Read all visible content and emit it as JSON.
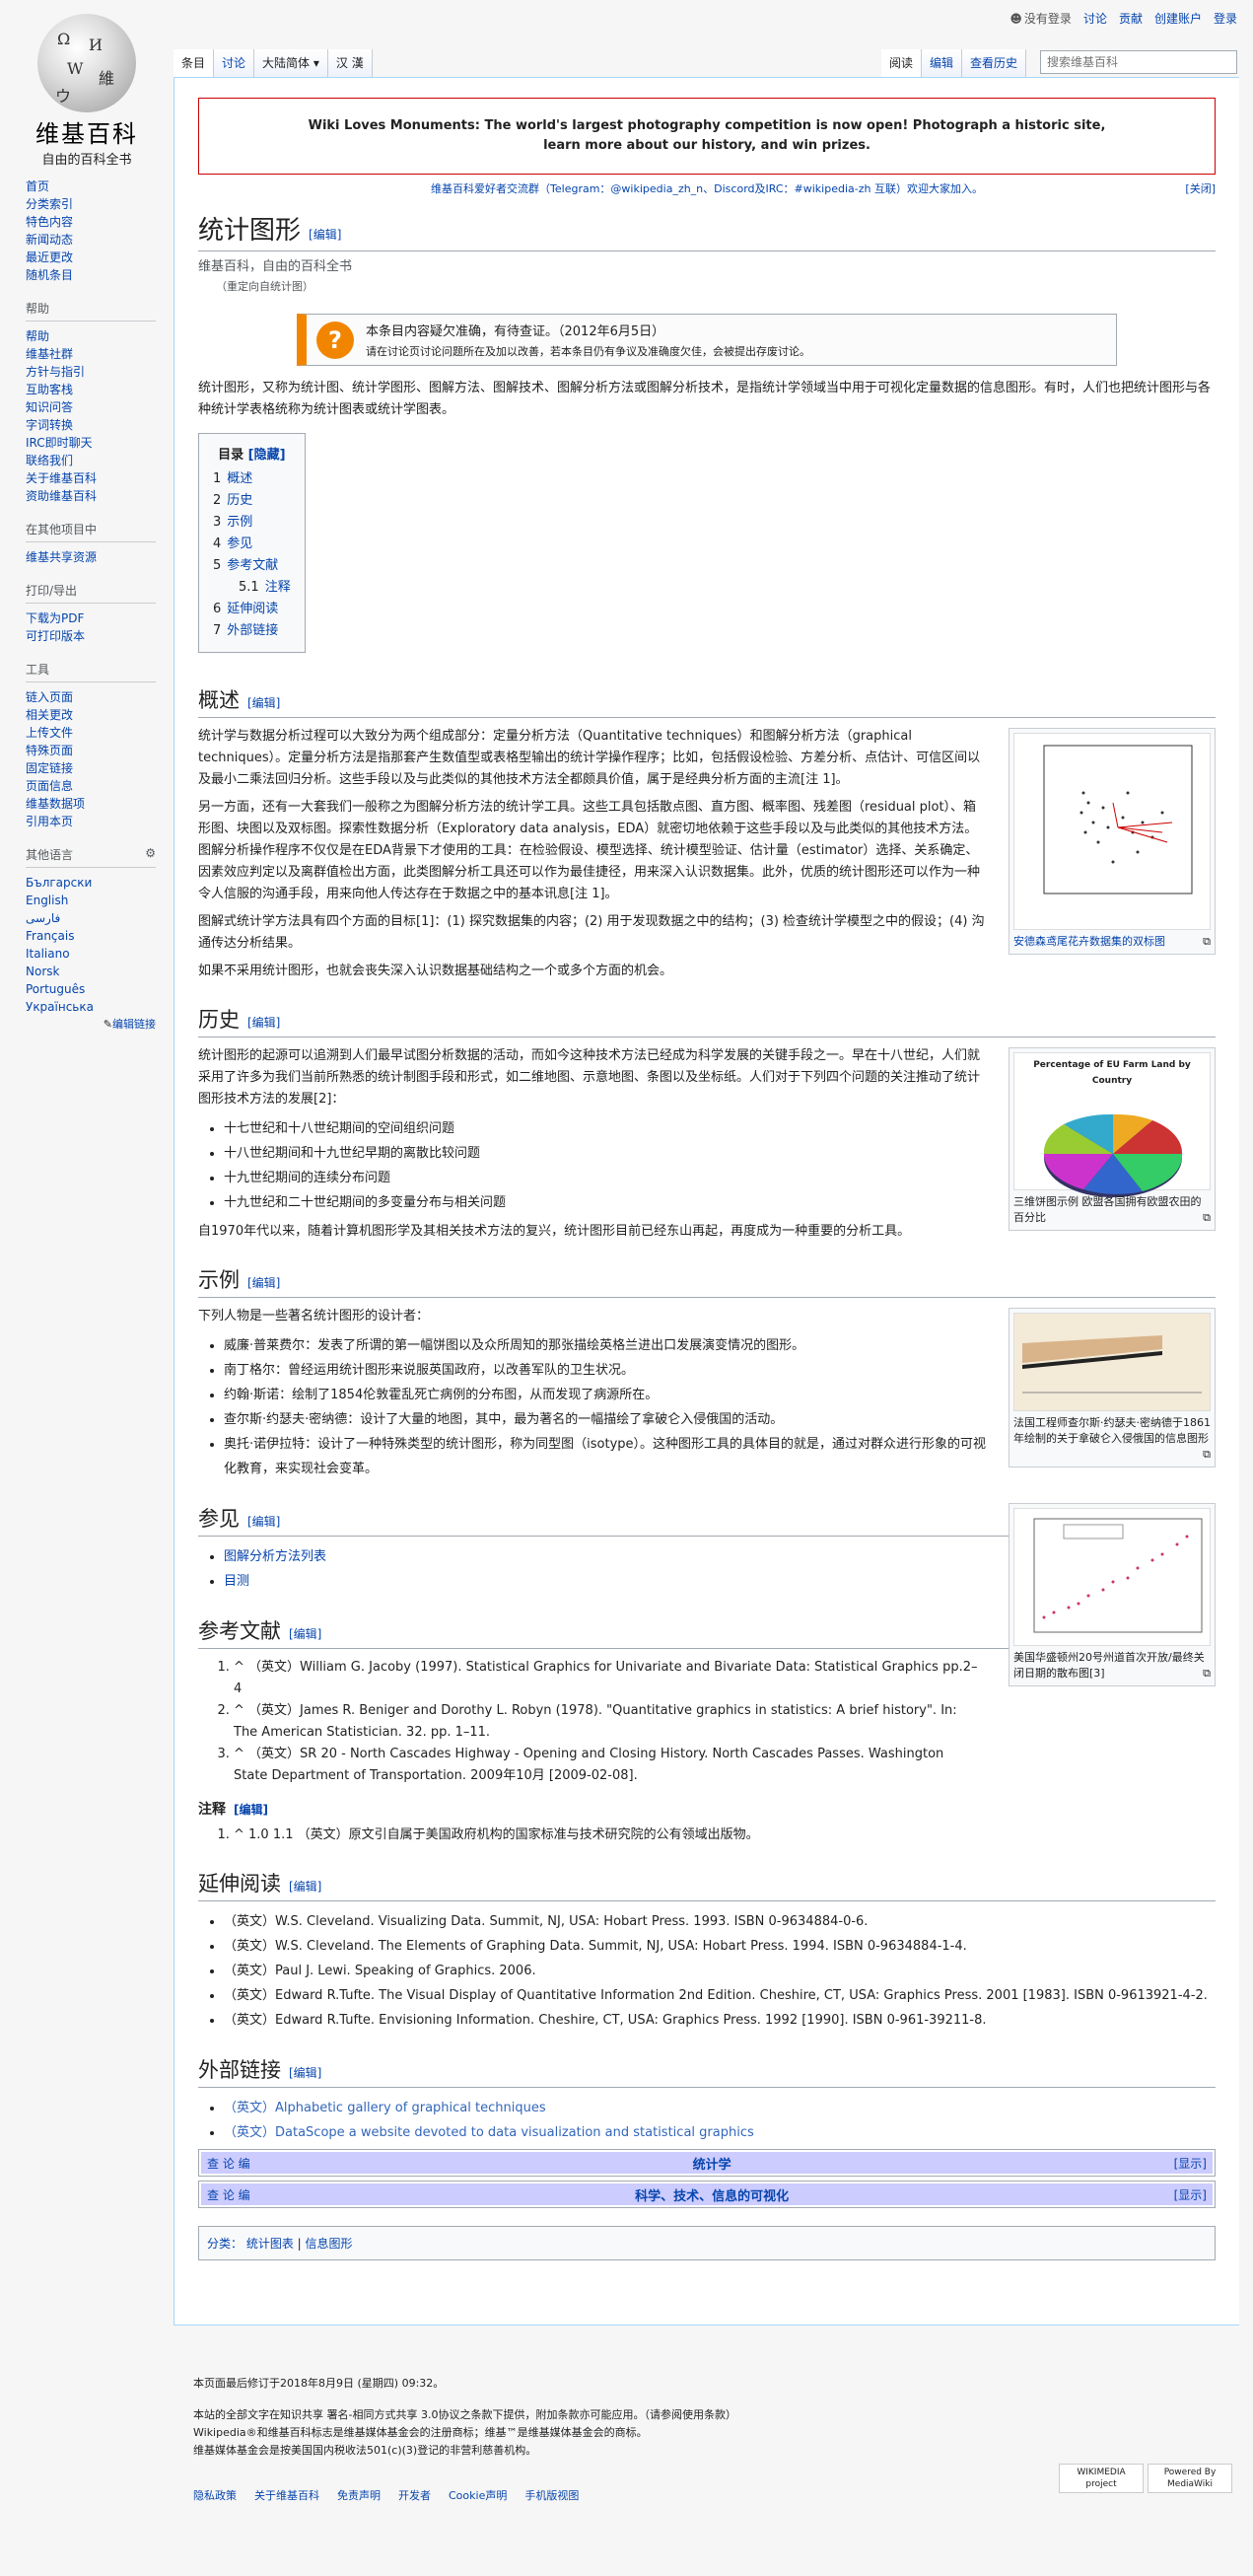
{
  "logo": {
    "title": "维基百科",
    "tagline": "自由的百科全书"
  },
  "personal": {
    "anon": "没有登录",
    "talk": "讨论",
    "contrib": "贡献",
    "create": "创建账户",
    "login": "登录"
  },
  "tabs": {
    "article": "条目",
    "talk": "讨论",
    "variant": "大陆简体",
    "lang": "汉 漢",
    "read": "阅读",
    "edit": "编辑",
    "history": "查看历史"
  },
  "search": {
    "placeholder": "搜索维基百科"
  },
  "sidebar": {
    "main": [
      "首页",
      "分类索引",
      "特色内容",
      "新闻动态",
      "最近更改",
      "随机条目"
    ],
    "help": {
      "title": "帮助",
      "items": [
        "帮助",
        "维基社群",
        "方针与指引",
        "互助客栈",
        "知识问答",
        "字词转换",
        "IRC即时聊天",
        "联络我们",
        "关于维基百科",
        "资助维基百科"
      ]
    },
    "other": {
      "title": "在其他项目中",
      "items": [
        "维基共享资源"
      ]
    },
    "print": {
      "title": "打印/导出",
      "items": [
        "下载为PDF",
        "可打印版本"
      ]
    },
    "tools": {
      "title": "工具",
      "items": [
        "链入页面",
        "相关更改",
        "上传文件",
        "特殊页面",
        "固定链接",
        "页面信息",
        "维基数据项",
        "引用本页"
      ]
    },
    "langs": {
      "title": "其他语言",
      "items": [
        "Български",
        "English",
        "فارسی",
        "Français",
        "Italiano",
        "Norsk",
        "Português",
        "Українська"
      ],
      "edit": "编辑链接"
    }
  },
  "notice": {
    "line1": "Wiki Loves Monuments: The world's largest photography competition is now open! Photograph a historic site,",
    "line2": "learn more about our history, and win prizes."
  },
  "community": {
    "text": "维基百科爱好者交流群（Telegram：@wikipedia_zh_n、Discord及IRC：#wikipedia-zh 互联）欢迎大家加入。",
    "close": "[关闭]"
  },
  "article": {
    "title": "统计图形",
    "edit": "[编辑]",
    "sub": "维基百科，自由的百科全书",
    "redirect": "（重定向自统计图）",
    "ambox": {
      "main": "本条目内容疑欠准确，有待查证。（2012年6月5日）",
      "sub": "请在讨论页讨论问题所在及加以改善，若本条目仍有争议及准确度欠佳，会被提出存废讨论。"
    },
    "intro": "统计图形，又称为统计图、统计学图形、图解方法、图解技术、图解分析方法或图解分析技术，是指统计学领域当中用于可视化定量数据的信息图形。有时，人们也把统计图形与各种统计学表格统称为统计图表或统计学图表。",
    "toc": {
      "title": "目录",
      "hide": "[隐藏]",
      "items": [
        {
          "n": "1",
          "t": "概述"
        },
        {
          "n": "2",
          "t": "历史"
        },
        {
          "n": "3",
          "t": "示例"
        },
        {
          "n": "4",
          "t": "参见"
        },
        {
          "n": "5",
          "t": "参考文献"
        },
        {
          "n": "5.1",
          "t": "注释"
        },
        {
          "n": "6",
          "t": "延伸阅读"
        },
        {
          "n": "7",
          "t": "外部链接"
        }
      ]
    },
    "s1": {
      "title": "概述",
      "p1": "统计学与数据分析过程可以大致分为两个组成部分：定量分析方法（Quantitative techniques）和图解分析方法（graphical techniques）。定量分析方法是指那套产生数值型或表格型输出的统计学操作程序；比如，包括假设检验、方差分析、点估计、可信区间以及最小二乘法回归分析。这些手段以及与此类似的其他技术方法全都颇具价值，属于是经典分析方面的主流[注 1]。",
      "p2": "另一方面，还有一大套我们一般称之为图解分析方法的统计学工具。这些工具包括散点图、直方图、概率图、残差图（residual plot）、箱形图、块图以及双标图。探索性数据分析（Exploratory data analysis，EDA）就密切地依赖于这些手段以及与此类似的其他技术方法。图解分析操作程序不仅仅是在EDA背景下才使用的工具：在检验假设、模型选择、统计模型验证、估计量（estimator）选择、关系确定、因素效应判定以及离群值检出方面，此类图解分析工具还可以作为最佳捷径，用来深入认识数据集。此外，优质的统计图形还可以作为一种令人信服的沟通手段，用来向他人传达存在于数据之中的基本讯息[注 1]。",
      "p3": "图解式统计学方法具有四个方面的目标[1]：(1) 探究数据集的内容；(2) 用于发现数据之中的结构；(3) 检查统计学模型之中的假设；(4) 沟通传达分析结果。",
      "p4": "如果不采用统计图形，也就会丧失深入认识数据基础结构之一个或多个方面的机会。",
      "caption": "安德森鸢尾花卉数据集的双标图"
    },
    "s2": {
      "title": "历史",
      "p1": "统计图形的起源可以追溯到人们最早试图分析数据的活动，而如今这种技术方法已经成为科学发展的关键手段之一。早在十八世纪，人们就采用了许多为我们当前所熟悉的统计制图手段和形式，如二维地图、示意地图、条图以及坐标纸。人们对于下列四个问题的关注推动了统计图形技术方法的发展[2]：",
      "items": [
        "十七世纪和十八世纪期间的空间组织问题",
        "十八世纪期间和十九世纪早期的离散比较问题",
        "十九世纪期间的连续分布问题",
        "十九世纪和二十世纪期间的多变量分布与相关问题"
      ],
      "p2": "自1970年代以来，随着计算机图形学及其相关技术方法的复兴，统计图形目前已经东山再起，再度成为一种重要的分析工具。",
      "caption": "三维饼图示例 欧盟各国拥有欧盟农田的百分比",
      "chart_title": "Percentage of EU Farm Land by Country"
    },
    "s3": {
      "title": "示例",
      "intro": "下列人物是一些著名统计图形的设计者：",
      "items": [
        "威廉·普莱费尔：发表了所谓的第一幅饼图以及众所周知的那张描绘英格兰进出口发展演变情况的图形。",
        "南丁格尔：曾经运用统计图形来说服英国政府，以改善军队的卫生状况。",
        "约翰·斯诺：绘制了1854伦敦霍乱死亡病例的分布图，从而发现了病源所在。",
        "查尔斯·约瑟夫·密纳德：设计了大量的地图，其中，最为著名的一幅描绘了拿破仑入侵俄国的活动。",
        "奥托·诺伊拉特：设计了一种特殊类型的统计图形，称为同型图（isotype）。这种图形工具的具体目的就是，通过对群众进行形象的可视化教育，来实现社会变革。"
      ],
      "caption": "法国工程师查尔斯·约瑟夫·密纳德于1861年绘制的关于拿破仑入侵俄国的信息图形"
    },
    "s4": {
      "title": "参见",
      "items": [
        "图解分析方法列表",
        "目测"
      ],
      "caption": "美国华盛顿州20号州道首次开放/最终关闭日期的散布图[3]"
    },
    "s5": {
      "title": "参考文献",
      "refs": [
        "^ （英文）William G. Jacoby (1997). Statistical Graphics for Univariate and Bivariate Data: Statistical Graphics pp.2–4",
        "^ （英文）James R. Beniger and Dorothy L. Robyn (1978). \"Quantitative graphics in statistics: A brief history\". In: The American Statistician. 32. pp. 1–11.",
        "^ （英文）SR 20 - North Cascades Highway - Opening and Closing History. North Cascades Passes. Washington State Department of Transportation. 2009年10月 [2009-02-08]."
      ],
      "notes_title": "注释",
      "note": "^ 1.0 1.1 （英文）原文引自属于美国政府机构的国家标准与技术研究院的公有领域出版物。"
    },
    "s6": {
      "title": "延伸阅读",
      "items": [
        "（英文）W.S. Cleveland. Visualizing Data. Summit, NJ, USA: Hobart Press. 1993. ISBN 0-9634884-0-6.",
        "（英文）W.S. Cleveland. The Elements of Graphing Data. Summit, NJ, USA: Hobart Press. 1994. ISBN 0-9634884-1-4.",
        "（英文）Paul J. Lewi. Speaking of Graphics. 2006.",
        "（英文）Edward R.Tufte. The Visual Display of Quantitative Information 2nd Edition. Cheshire, CT, USA: Graphics Press. 2001 [1983]. ISBN 0-9613921-4-2.",
        "（英文）Edward R.Tufte. Envisioning Information. Cheshire, CT, USA: Graphics Press. 1992 [1990]. ISBN 0-961-39211-8."
      ]
    },
    "s7": {
      "title": "外部链接",
      "items": [
        "（英文）Alphabetic gallery of graphical techniques",
        "（英文）DataScope a website devoted to data visualization and statistical graphics"
      ]
    },
    "navbox": [
      {
        "vde": "查 论 编",
        "title": "统计学",
        "show": "[显示]"
      },
      {
        "vde": "查 论 编",
        "title": "科学、技术、信息的可视化",
        "show": "[显示]"
      }
    ],
    "categories": {
      "label": "分类：",
      "items": [
        "统计图表",
        "信息图形"
      ]
    }
  },
  "footer": {
    "modified": "本页面最后修订于2018年8月9日 (星期四) 09:32。",
    "license1": "本站的全部文字在知识共享 署名-相同方式共享 3.0协议之条款下提供，附加条款亦可能应用。（请参阅使用条款）",
    "license2": "Wikipedia®和维基百科标志是维基媒体基金会的注册商标；维基™是维基媒体基金会的商标。",
    "license3": "维基媒体基金会是按美国国内税收法501(c)(3)登记的非营利慈善机构。",
    "links": [
      "隐私政策",
      "关于维基百科",
      "免责声明",
      "开发者",
      "Cookie声明",
      "手机版视图"
    ],
    "badge1": "WIKIMEDIA project",
    "badge2": "Powered By MediaWiki"
  }
}
